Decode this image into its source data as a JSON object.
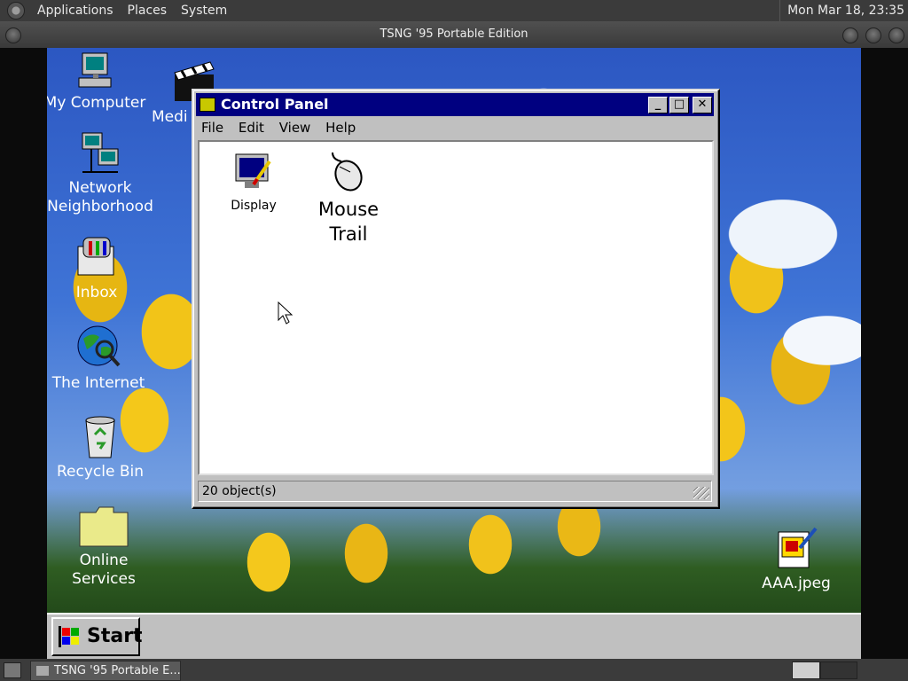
{
  "top_panel": {
    "menus": [
      "Applications",
      "Places",
      "System"
    ],
    "clock": "Mon Mar 18, 23:35"
  },
  "outer_window": {
    "title": "TSNG '95 Portable Edition"
  },
  "desktop": {
    "icons": [
      {
        "label": "My Computer",
        "icon": "my-computer-icon"
      },
      {
        "label": "Medi",
        "icon": "media-clapper-icon"
      },
      {
        "label": "Network Neighborhood",
        "icon": "network-icon"
      },
      {
        "label": "Inbox",
        "icon": "inbox-icon"
      },
      {
        "label": "The Internet",
        "icon": "internet-globe-icon"
      },
      {
        "label": "Recycle Bin",
        "icon": "recycle-bin-icon"
      },
      {
        "label": "Online Services",
        "icon": "folder-icon"
      },
      {
        "label": "AAA.jpeg",
        "icon": "image-file-icon"
      }
    ]
  },
  "control_panel": {
    "title": "Control Panel",
    "menu": [
      "File",
      "Edit",
      "View",
      "Help"
    ],
    "items": [
      {
        "label": "Display",
        "icon": "display-icon"
      },
      {
        "label": "Mouse Trail",
        "icon": "mouse-icon"
      }
    ],
    "status": "20 object(s)"
  },
  "win_taskbar": {
    "start_label": "Start"
  },
  "bottom_panel": {
    "task_label": "TSNG '95 Portable E..."
  },
  "colors": {
    "titlebar": "#000080",
    "face": "#c0c0c0",
    "gnome_panel": "#3b3b3b"
  }
}
